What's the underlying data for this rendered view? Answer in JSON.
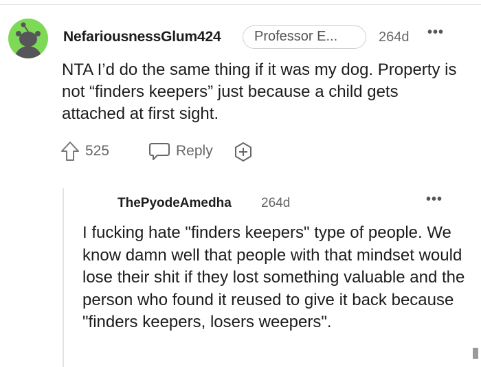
{
  "comment": {
    "username": "NefariousnessGlum424",
    "flair": "Professor E...",
    "age": "264d",
    "more_label": "•••",
    "body": "NTA I’d do the same thing if it was my dog. Property is not “finders keepers” just because a child gets attached at first sight.",
    "upvotes": "525",
    "reply_label": "Reply",
    "icons": {
      "avatar": "reddit-snoo-avatar",
      "upvote": "upvote-arrow-icon",
      "reply": "speech-bubble-icon",
      "award": "award-plus-icon"
    }
  },
  "reply": {
    "username": "ThePyodeAmedha",
    "age": "264d",
    "more_label": "•••",
    "body": "I fucking hate \"finders keepers\" type of people. We know damn well that people with that mindset would lose their shit if they lost something valuable and the person who found it reused to give it back because \"finders keepers, losers weepers\"."
  },
  "colors": {
    "avatar_bg": "#7ed957",
    "text": "#1c1c1c",
    "muted": "#666666",
    "thread_line": "#e3e3e3"
  }
}
